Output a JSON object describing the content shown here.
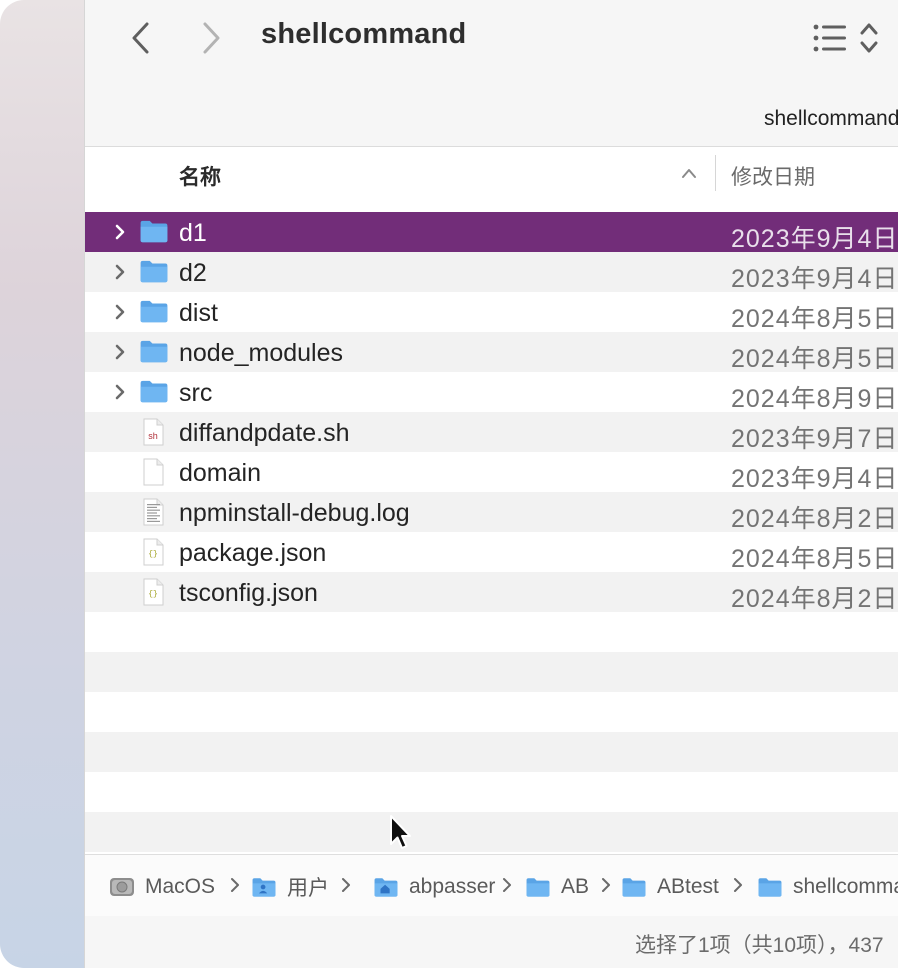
{
  "window": {
    "title": "shellcommand",
    "path_label": "shellcommand"
  },
  "toolbar": {
    "back_icon": "chevron-left-icon",
    "forward_icon": "chevron-right-icon",
    "view_icon": "list-view-icon",
    "sort_icon": "up-down-chevron-icon"
  },
  "columns": {
    "name": "名称",
    "date": "修改日期"
  },
  "files": [
    {
      "name": "d1",
      "date": "2023年9月4日",
      "kind": "folder",
      "selected": true
    },
    {
      "name": "d2",
      "date": "2023年9月4日",
      "kind": "folder",
      "selected": false
    },
    {
      "name": "dist",
      "date": "2024年8月5日",
      "kind": "folder",
      "selected": false
    },
    {
      "name": "node_modules",
      "date": "2024年8月5日",
      "kind": "folder",
      "selected": false
    },
    {
      "name": "src",
      "date": "2024年8月9日",
      "kind": "folder",
      "selected": false
    },
    {
      "name": "diffandpdate.sh",
      "date": "2023年9月7日",
      "kind": "shell-script",
      "icon_text": "sh",
      "selected": false
    },
    {
      "name": "domain",
      "date": "2023年9月4日",
      "kind": "document",
      "selected": false
    },
    {
      "name": "npminstall-debug.log",
      "date": "2024年8月2日",
      "kind": "log",
      "selected": false
    },
    {
      "name": "package.json",
      "date": "2024年8月5日",
      "kind": "json",
      "icon_text": "{}",
      "selected": false
    },
    {
      "name": "tsconfig.json",
      "date": "2024年8月2日",
      "kind": "json",
      "icon_text": "{}",
      "selected": false
    }
  ],
  "pathbar": [
    {
      "label": "MacOS",
      "icon": "hard-drive-icon"
    },
    {
      "label": "用户",
      "icon": "users-folder-icon"
    },
    {
      "label": "abpasser",
      "icon": "home-folder-icon"
    },
    {
      "label": "AB",
      "icon": "folder-icon"
    },
    {
      "label": "ABtest",
      "icon": "folder-icon"
    },
    {
      "label": "shellcommand",
      "icon": "folder-icon"
    }
  ],
  "status": "选择了1项（共10项），437",
  "colors": {
    "selection": "#722d79",
    "folder": "#5aa4e6"
  }
}
